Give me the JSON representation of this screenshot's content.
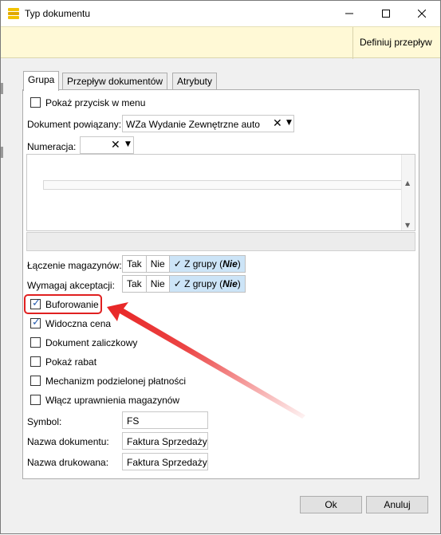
{
  "window": {
    "title": "Typ dokumentu",
    "controls": {
      "minimize_icon": "minimize-icon",
      "maximize_icon": "maximize-icon",
      "close_icon": "close-icon"
    }
  },
  "toolbar": {
    "define_flow_label": "Definiuj przepływ"
  },
  "tabs": [
    {
      "label": "Grupa",
      "active": true
    },
    {
      "label": "Przepływ dokumentów",
      "active": false
    },
    {
      "label": "Atrybuty",
      "active": false
    }
  ],
  "form": {
    "show_button_in_menu": {
      "label": "Pokaż przycisk w menu",
      "checked": false
    },
    "related_document": {
      "label": "Dokument powiązany:",
      "value": "WZa Wydanie Zewnętrzne auto"
    },
    "numbering": {
      "label": "Numeracja:",
      "value": ""
    },
    "warehouse_linking": {
      "label": "Łączenie magazynów:",
      "options": [
        "Tak",
        "Nie",
        "Z grupy (Nie)"
      ],
      "selected": "Z grupy (Nie)"
    },
    "require_approval": {
      "label": "Wymagaj akceptacji:",
      "options": [
        "Tak",
        "Nie",
        "Z grupy (Nie)"
      ],
      "selected": "Z grupy (Nie)"
    },
    "buffering": {
      "label": "Buforowanie",
      "checked": true
    },
    "visible_price": {
      "label": "Widoczna cena",
      "checked": true
    },
    "advance_document": {
      "label": "Dokument zaliczkowy",
      "checked": false
    },
    "show_discount": {
      "label": "Pokaż rabat",
      "checked": false
    },
    "split_payment": {
      "label": "Mechanizm podzielonej płatności",
      "checked": false
    },
    "warehouse_permissions": {
      "label": "Włącz uprawnienia magazynów",
      "checked": false
    },
    "symbol": {
      "label": "Symbol:",
      "value": "FS"
    },
    "document_name": {
      "label": "Nazwa dokumentu:",
      "value": "Faktura Sprzedaży"
    },
    "printed_name": {
      "label": "Nazwa drukowana:",
      "value": "Faktura Sprzedaży"
    }
  },
  "seg_labels": {
    "tak": "Tak",
    "nie": "Nie",
    "zgrupy_prefix": "Z grupy (",
    "zgrupy_value": "Nie",
    "zgrupy_suffix": ")"
  },
  "footer": {
    "ok_label": "Ok",
    "cancel_label": "Anuluj"
  },
  "colors": {
    "toolbar_bg": "#fff9d6",
    "selected_segment": "#cce4f7",
    "highlight": "#e02020",
    "arrow": "#e82424"
  }
}
